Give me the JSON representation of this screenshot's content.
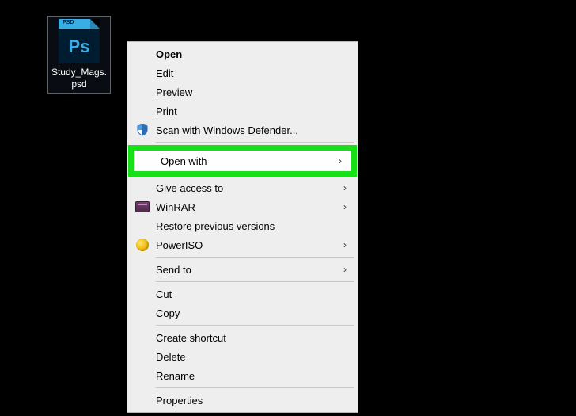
{
  "file": {
    "name": "Study_Mags.psd",
    "badge": "PSD",
    "ps_logo": "Ps"
  },
  "menu": {
    "open": "Open",
    "edit": "Edit",
    "preview": "Preview",
    "print": "Print",
    "scan_defender": "Scan with Windows Defender...",
    "open_with": "Open with",
    "give_access": "Give access to",
    "winrar": "WinRAR",
    "restore_prev": "Restore previous versions",
    "poweriso": "PowerISO",
    "send_to": "Send to",
    "cut": "Cut",
    "copy": "Copy",
    "create_shortcut": "Create shortcut",
    "delete": "Delete",
    "rename": "Rename",
    "properties": "Properties"
  },
  "glyphs": {
    "submenu_arrow": "›"
  },
  "colors": {
    "highlight": "#18e018",
    "menu_bg": "#eeeeee",
    "desktop_bg": "#000000"
  }
}
